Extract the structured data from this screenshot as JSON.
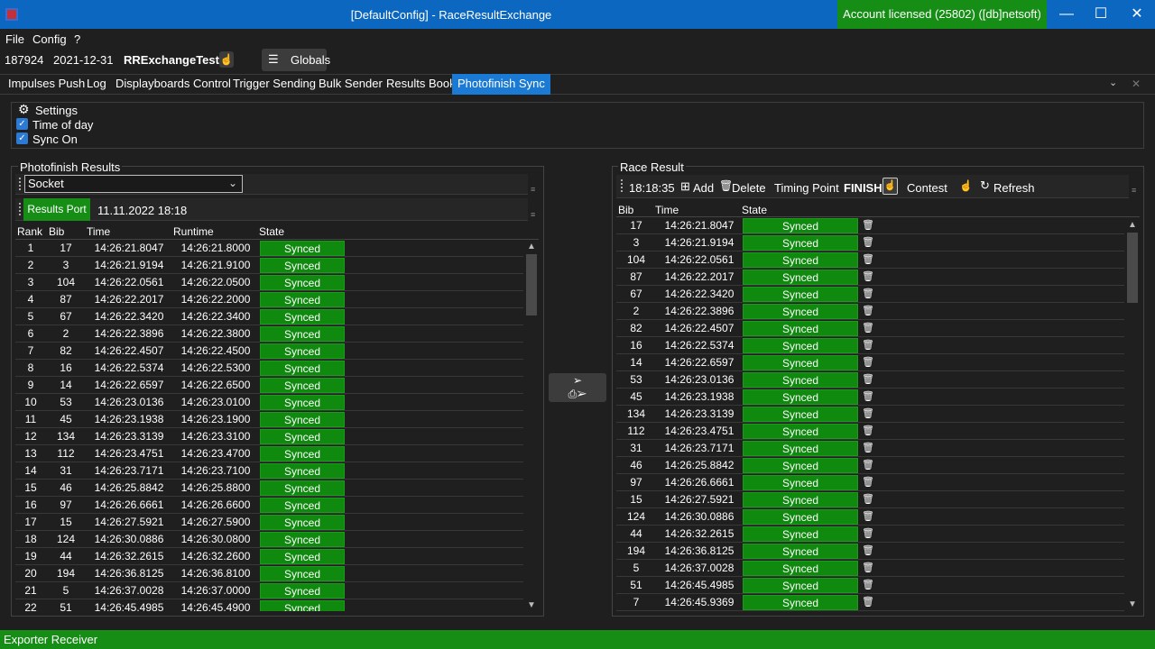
{
  "window": {
    "title": "[DefaultConfig] - RaceResultExchange",
    "license": "Account licensed (25802) ([db]netsoft)",
    "min_icon": "—",
    "max_icon": "☐",
    "close_icon": "✕"
  },
  "menu": [
    "File",
    "Config",
    "?"
  ],
  "info": {
    "event_id": "187924",
    "date": "2021-12-31",
    "name": "RRExchangeTest",
    "globals_label": "Globals"
  },
  "tabs": [
    "Impulses Push",
    "Log",
    "Displayboards Control",
    "Trigger Sending",
    "Bulk Sender",
    "Results Book",
    "Photofinish Sync"
  ],
  "settings": {
    "title": "Settings",
    "time_of_day": "Time of day",
    "sync_on": "Sync On"
  },
  "photofinish": {
    "title": "Photofinish Results",
    "connection": "Socket",
    "port_label": "Results Port",
    "timestamp": "11.11.2022 18:18",
    "headers": [
      "Rank",
      "Bib",
      "Time",
      "Runtime",
      "State"
    ],
    "rows": [
      [
        "1",
        "17",
        "14:26:21.8047",
        "14:26:21.8000",
        "Synced"
      ],
      [
        "2",
        "3",
        "14:26:21.9194",
        "14:26:21.9100",
        "Synced"
      ],
      [
        "3",
        "104",
        "14:26:22.0561",
        "14:26:22.0500",
        "Synced"
      ],
      [
        "4",
        "87",
        "14:26:22.2017",
        "14:26:22.2000",
        "Synced"
      ],
      [
        "5",
        "67",
        "14:26:22.3420",
        "14:26:22.3400",
        "Synced"
      ],
      [
        "6",
        "2",
        "14:26:22.3896",
        "14:26:22.3800",
        "Synced"
      ],
      [
        "7",
        "82",
        "14:26:22.4507",
        "14:26:22.4500",
        "Synced"
      ],
      [
        "8",
        "16",
        "14:26:22.5374",
        "14:26:22.5300",
        "Synced"
      ],
      [
        "9",
        "14",
        "14:26:22.6597",
        "14:26:22.6500",
        "Synced"
      ],
      [
        "10",
        "53",
        "14:26:23.0136",
        "14:26:23.0100",
        "Synced"
      ],
      [
        "11",
        "45",
        "14:26:23.1938",
        "14:26:23.1900",
        "Synced"
      ],
      [
        "12",
        "134",
        "14:26:23.3139",
        "14:26:23.3100",
        "Synced"
      ],
      [
        "13",
        "112",
        "14:26:23.4751",
        "14:26:23.4700",
        "Synced"
      ],
      [
        "14",
        "31",
        "14:26:23.7171",
        "14:26:23.7100",
        "Synced"
      ],
      [
        "15",
        "46",
        "14:26:25.8842",
        "14:26:25.8800",
        "Synced"
      ],
      [
        "16",
        "97",
        "14:26:26.6661",
        "14:26:26.6600",
        "Synced"
      ],
      [
        "17",
        "15",
        "14:26:27.5921",
        "14:26:27.5900",
        "Synced"
      ],
      [
        "18",
        "124",
        "14:26:30.0886",
        "14:26:30.0800",
        "Synced"
      ],
      [
        "19",
        "44",
        "14:26:32.2615",
        "14:26:32.2600",
        "Synced"
      ],
      [
        "20",
        "194",
        "14:26:36.8125",
        "14:26:36.8100",
        "Synced"
      ],
      [
        "21",
        "5",
        "14:26:37.0028",
        "14:26:37.0000",
        "Synced"
      ],
      [
        "22",
        "51",
        "14:26:45.4985",
        "14:26:45.4900",
        "Synced"
      ]
    ]
  },
  "race": {
    "title": "Race Result",
    "time": "18:18:35",
    "add_label": "Add",
    "delete_label": "Delete",
    "timing_point_label": "Timing Point",
    "timing_point_value": "FINISH",
    "contest_label": "Contest",
    "refresh_label": "Refresh",
    "headers": [
      "Bib",
      "Time",
      "State"
    ],
    "rows": [
      [
        "17",
        "14:26:21.8047",
        "Synced"
      ],
      [
        "3",
        "14:26:21.9194",
        "Synced"
      ],
      [
        "104",
        "14:26:22.0561",
        "Synced"
      ],
      [
        "87",
        "14:26:22.2017",
        "Synced"
      ],
      [
        "67",
        "14:26:22.3420",
        "Synced"
      ],
      [
        "2",
        "14:26:22.3896",
        "Synced"
      ],
      [
        "82",
        "14:26:22.4507",
        "Synced"
      ],
      [
        "16",
        "14:26:22.5374",
        "Synced"
      ],
      [
        "14",
        "14:26:22.6597",
        "Synced"
      ],
      [
        "53",
        "14:26:23.0136",
        "Synced"
      ],
      [
        "45",
        "14:26:23.1938",
        "Synced"
      ],
      [
        "134",
        "14:26:23.3139",
        "Synced"
      ],
      [
        "112",
        "14:26:23.4751",
        "Synced"
      ],
      [
        "31",
        "14:26:23.7171",
        "Synced"
      ],
      [
        "46",
        "14:26:25.8842",
        "Synced"
      ],
      [
        "97",
        "14:26:26.6661",
        "Synced"
      ],
      [
        "15",
        "14:26:27.5921",
        "Synced"
      ],
      [
        "124",
        "14:26:30.0886",
        "Synced"
      ],
      [
        "44",
        "14:26:32.2615",
        "Synced"
      ],
      [
        "194",
        "14:26:36.8125",
        "Synced"
      ],
      [
        "5",
        "14:26:37.0028",
        "Synced"
      ],
      [
        "51",
        "14:26:45.4985",
        "Synced"
      ],
      [
        "7",
        "14:26:45.9369",
        "Synced"
      ]
    ]
  },
  "status": "Exporter Receiver",
  "colors": {
    "accent": "#1a7ad4",
    "license": "#168e16",
    "synced": "#0f8a0f",
    "titlebar": "#0b67bf"
  }
}
